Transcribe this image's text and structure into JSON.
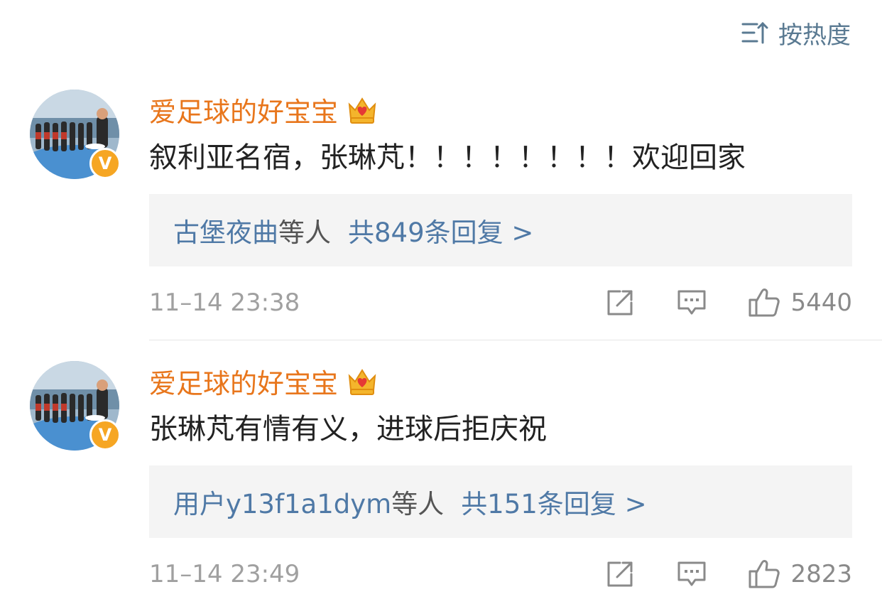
{
  "sort": {
    "label": "按热度",
    "icon": "sort-icon"
  },
  "comments": [
    {
      "username": "爱足球的好宝宝",
      "badge": "V",
      "text": "叙利亚名宿，张琳芃！！！！！！！！欢迎回家",
      "reply_names": "古堡夜曲",
      "reply_suffix": "等人",
      "reply_count": "共849条回复 >",
      "time": "11–14 23:38",
      "likes": "5440"
    },
    {
      "username": "爱足球的好宝宝",
      "badge": "V",
      "text": "张琳芃有情有义，进球后拒庆祝",
      "reply_names": "用户y13f1a1dym",
      "reply_suffix": "等人",
      "reply_count": "共151条回复 >",
      "time": "11–14 23:49",
      "likes": "2823"
    }
  ],
  "colors": {
    "username": "#e8761c",
    "link": "#4f79a6",
    "badge": "#f6a623",
    "meta": "#a0a0a0"
  }
}
